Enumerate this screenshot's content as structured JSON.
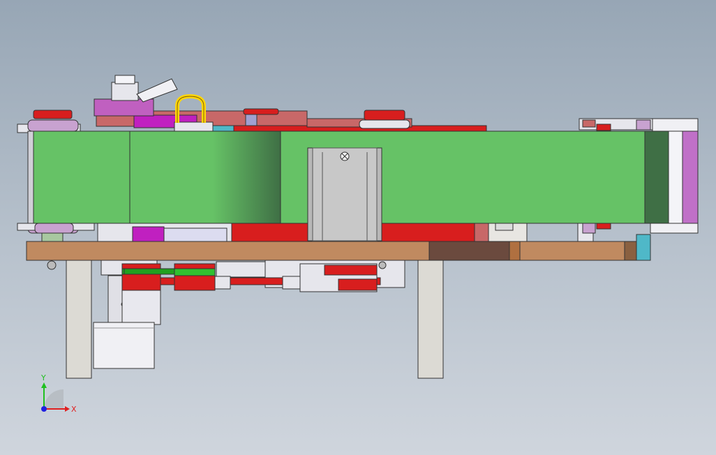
{
  "viewport": {
    "background_top": "#97a6b5",
    "background_bottom": "#cfd5dd"
  },
  "colors": {
    "belt_green": "#66c266",
    "belt_shadow": "#3f6f45",
    "wood": "#c08a60",
    "wood_dark": "#6b4a3e",
    "red_part": "#d81e1e",
    "magenta_part": "#c020c0",
    "pink_part": "#c86868",
    "yellow_handle": "#ffd60a",
    "motor_gray": "#b8b8b8",
    "metal_light": "#e6e6ec",
    "lavender": "#c8a2d0",
    "teal": "#4fb8c8",
    "leg_color": "#dcdad4"
  },
  "axis_triad": {
    "x_label": "X",
    "y_label": "Y",
    "x_color": "#e02020",
    "y_color": "#20c020",
    "z_color": "#2020e0"
  }
}
